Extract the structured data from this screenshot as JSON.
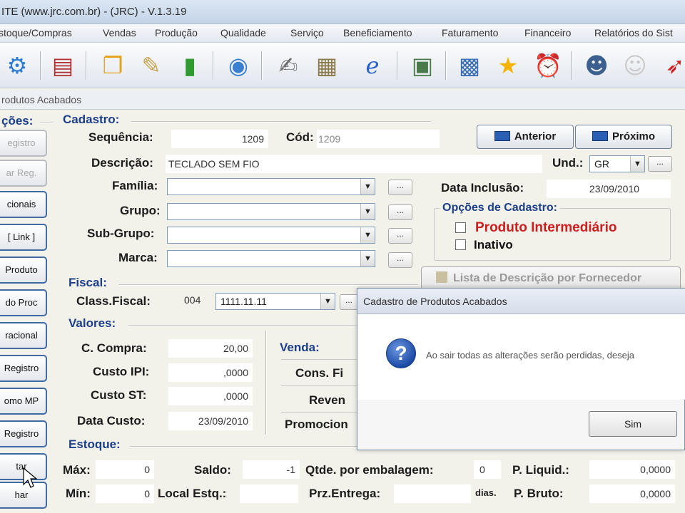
{
  "window": {
    "title": "ITE (www.jrc.com.br) - (JRC) - V.1.3.19"
  },
  "menu": {
    "items": [
      "stoque/Compras",
      "Vendas",
      "Produção",
      "Qualidade",
      "Serviço",
      "Beneficiamento",
      "Faturamento",
      "Financeiro",
      "Relatórios do Sist"
    ]
  },
  "toolbar": {
    "icons": [
      "gear-icon",
      "book-icon",
      "documents-icon",
      "notepad-icon",
      "bar-chart-icon",
      "globe-gear-icon",
      "edit-document-icon",
      "spreadsheet-icon",
      "ie-browser-icon",
      "id-card-icon",
      "calculator-icon",
      "star-icon",
      "alarm-clock-icon",
      "users-icon",
      "user-faded-icon",
      "running-man-icon"
    ]
  },
  "form_window": {
    "title": "rodutos Acabados"
  },
  "sidebar": {
    "header": "ções:",
    "buttons": [
      "egistro",
      "ar Reg.",
      "cionais",
      "[ Link ]",
      "Produto",
      "do Proc",
      "racional",
      "Registro",
      "omo MP",
      "Registro",
      "tar",
      "har"
    ]
  },
  "cadastro": {
    "section": "Cadastro:",
    "sequencia_label": "Sequência:",
    "sequencia_value": "1209",
    "cod_label": "Cód:",
    "cod_value": "1209",
    "descricao_label": "Descrição:",
    "descricao_value": "TECLADO SEM FIO",
    "und_label": "Und.:",
    "und_value": "GR",
    "familia_label": "Família:",
    "grupo_label": "Grupo:",
    "subgrupo_label": "Sub-Grupo:",
    "marca_label": "Marca:",
    "anterior": "Anterior",
    "proximo": "Próximo",
    "data_inclusao_label": "Data Inclusão:",
    "data_inclusao_value": "23/09/2010",
    "ellipsis": "...",
    "opcoes_title": "Opções de Cadastro:",
    "produto_intermediario": "Produto Intermediário",
    "inativo": "Inativo",
    "lista_descricao": "Lista de Descrição por Fornecedor"
  },
  "fiscal": {
    "section": "Fiscal:",
    "class_label": "Class.Fiscal:",
    "class_code": "004",
    "class_value": "1111.11.11"
  },
  "valores": {
    "section": "Valores:",
    "c_compra_label": "C. Compra:",
    "c_compra_value": "20,00",
    "custo_ipi_label": "Custo IPI:",
    "custo_ipi_value": ",0000",
    "custo_st_label": "Custo ST:",
    "custo_st_value": ",0000",
    "data_custo_label": "Data Custo:",
    "data_custo_value": "23/09/2010",
    "venda_label": "Venda:",
    "cons_final_label": "Cons. Fi",
    "revenda_label": "Reven",
    "promocional_label": "Promocion"
  },
  "estoque": {
    "section": "Estoque:",
    "max_label": "Máx:",
    "max_value": "0",
    "min_label": "Mín:",
    "min_value": "0",
    "saldo_label": "Saldo:",
    "saldo_value": "-1",
    "local_label": "Local Estq.:",
    "qtde_label": "Qtde. por embalagem:",
    "qtde_value": "0",
    "prz_label": "Prz.Entrega:",
    "dias_label": "dias.",
    "p_liquido_label": "P. Liquid.:",
    "p_liquido_value": "0,0000",
    "p_bruto_label": "P. Bruto:",
    "p_bruto_value": "0,0000"
  },
  "dialog": {
    "title": "Cadastro de Produtos Acabados",
    "message": "Ao sair todas as alterações serão perdidas, deseja",
    "sim": "Sim"
  },
  "colors": {
    "section_blue": "#1c3f8a",
    "highlight_red": "#cc1f1f",
    "button_border": "#3f6ba4"
  }
}
